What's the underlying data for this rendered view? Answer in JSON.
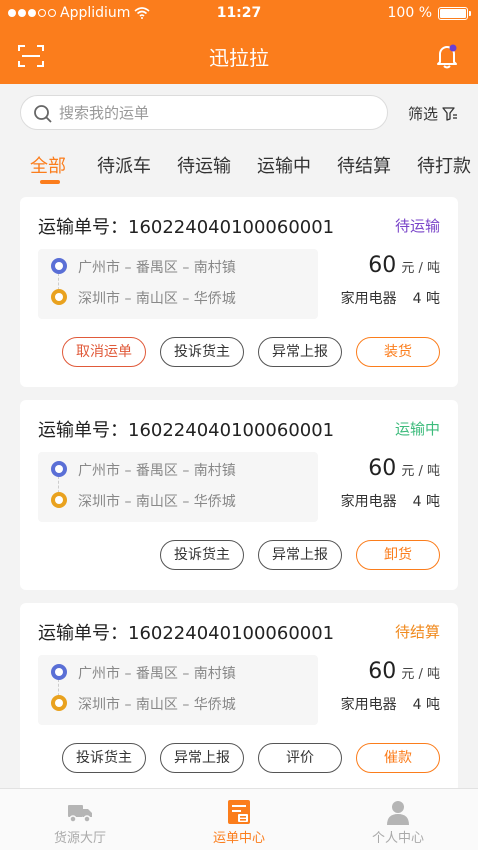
{
  "status_bar": {
    "carrier": "Applidium",
    "time": "11:27",
    "battery": "100 %"
  },
  "header": {
    "title": "迅拉拉"
  },
  "search": {
    "placeholder": "搜索我的运单",
    "filter_label": "筛选"
  },
  "tabs": [
    {
      "label": "全部",
      "active": true
    },
    {
      "label": "待派车"
    },
    {
      "label": "待运输"
    },
    {
      "label": "运输中"
    },
    {
      "label": "待结算"
    },
    {
      "label": "待打款"
    }
  ],
  "orders": [
    {
      "order_label": "运输单号：160224040100060001",
      "status": "待运输",
      "status_color": "#7a45c9",
      "from": "广州市 – 番禺区 – 南村镇",
      "to": "深圳市 – 南山区 – 华侨城",
      "price": "60",
      "price_unit": "元 / 吨",
      "cargo": "家用电器",
      "weight": "4 吨",
      "actions": [
        "取消运单",
        "投诉货主",
        "异常上报",
        "装货"
      ]
    },
    {
      "order_label": "运输单号：160224040100060001",
      "status": "运输中",
      "status_color": "#3dbb7c",
      "from": "广州市 – 番禺区 – 南村镇",
      "to": "深圳市 – 南山区 – 华侨城",
      "price": "60",
      "price_unit": "元 / 吨",
      "cargo": "家用电器",
      "weight": "4 吨",
      "actions": [
        "投诉货主",
        "异常上报",
        "卸货"
      ]
    },
    {
      "order_label": "运输单号：160224040100060001",
      "status": "待结算",
      "status_color": "#f08a1e",
      "from": "广州市 – 番禺区 – 南村镇",
      "to": "深圳市 – 南山区 – 华侨城",
      "price": "60",
      "price_unit": "元 / 吨",
      "cargo": "家用电器",
      "weight": "4 吨",
      "actions": [
        "投诉货主",
        "异常上报",
        "评价",
        "催款"
      ]
    }
  ],
  "tabbar": [
    {
      "label": "货源大厅",
      "icon": "truck-icon"
    },
    {
      "label": "运单中心",
      "icon": "waybill-icon",
      "active": true
    },
    {
      "label": "个人中心",
      "icon": "person-icon"
    }
  ],
  "colors": {
    "accent": "#fb7d1c"
  }
}
